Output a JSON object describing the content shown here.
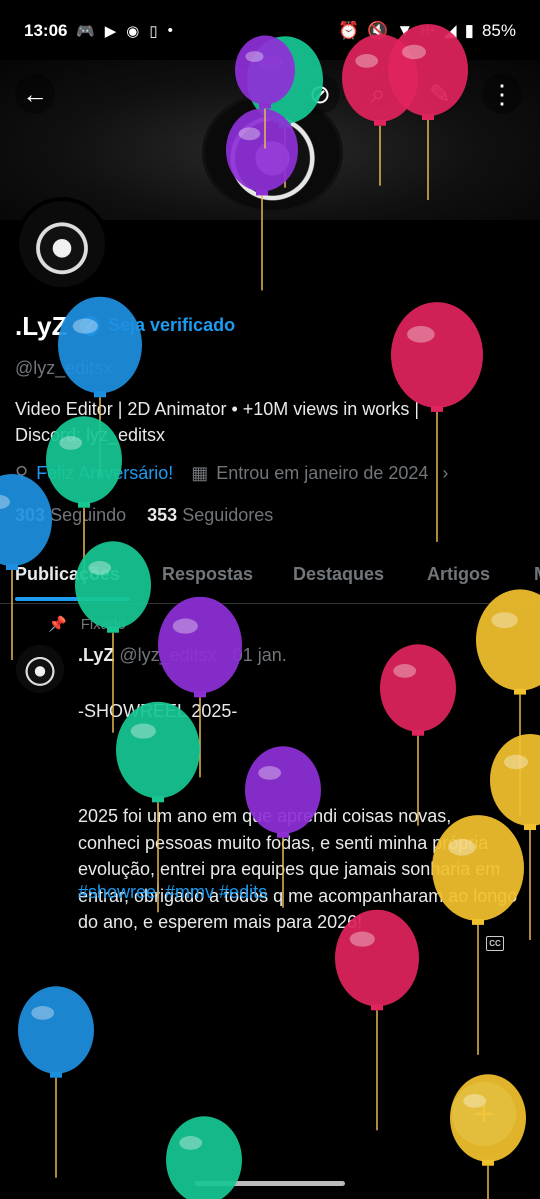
{
  "status_bar": {
    "time": "13:06",
    "left_icons": [
      "discord-icon",
      "youtube-icon",
      "reddit-icon",
      "phone-icon",
      "dot-icon"
    ],
    "right_icons": [
      "alarm-icon",
      "mute-icon",
      "wifi-icon",
      "network-icon",
      "signal-icon",
      "battery-icon"
    ],
    "network": "H+",
    "battery": "85%"
  },
  "header": {
    "back_icon": "arrow-left-icon",
    "buttons": [
      "no-broadcast-icon",
      "search-icon",
      "edit-icon",
      "more-vert-icon"
    ]
  },
  "profile": {
    "name": ".LyZ",
    "verify_label": "Seja verificado",
    "handle": "@lyz_editsx",
    "bio_line1": "Video Editor | 2D Animator • +10M views in works |",
    "bio_line2": "Discord: lyz_editsx",
    "birthday": "Feliz Aniversário!",
    "joined": "Entrou em janeiro de 2024",
    "following_count": "303",
    "following_label": "Seguindo",
    "followers_count": "353",
    "followers_label": "Seguidores"
  },
  "tabs": [
    "Publicações",
    "Respostas",
    "Destaques",
    "Artigos",
    "M"
  ],
  "post": {
    "pinned_label": "Fixado",
    "author_name": ".LyZ",
    "author_handle": "@lyz_editsx",
    "separator": "·",
    "date": "01 jan.",
    "title": "-SHOWREEL 2025-",
    "body": "2025 foi um ano em que aprendi coisas novas, conheci pessoas muito fodas, e senti minha própria evolução, entrei pra equipes que jamais sonharia em entrar, obrigado a todos q me acompanharam ao longo do ano, e esperem mais para 2026!",
    "hashtags": "#showreel #mmv #edits",
    "cc_label": "CC",
    "more_icon": "more-vert-icon"
  },
  "fab": {
    "icon": "plus-icon",
    "label": "+"
  },
  "colors": {
    "accent": "#1d9bf0",
    "balloon_red": "#e0245e",
    "balloon_blue": "#1d8fe0",
    "balloon_green": "#17c793",
    "balloon_purple": "#8e2fd6",
    "balloon_yellow": "#f2c12e"
  }
}
